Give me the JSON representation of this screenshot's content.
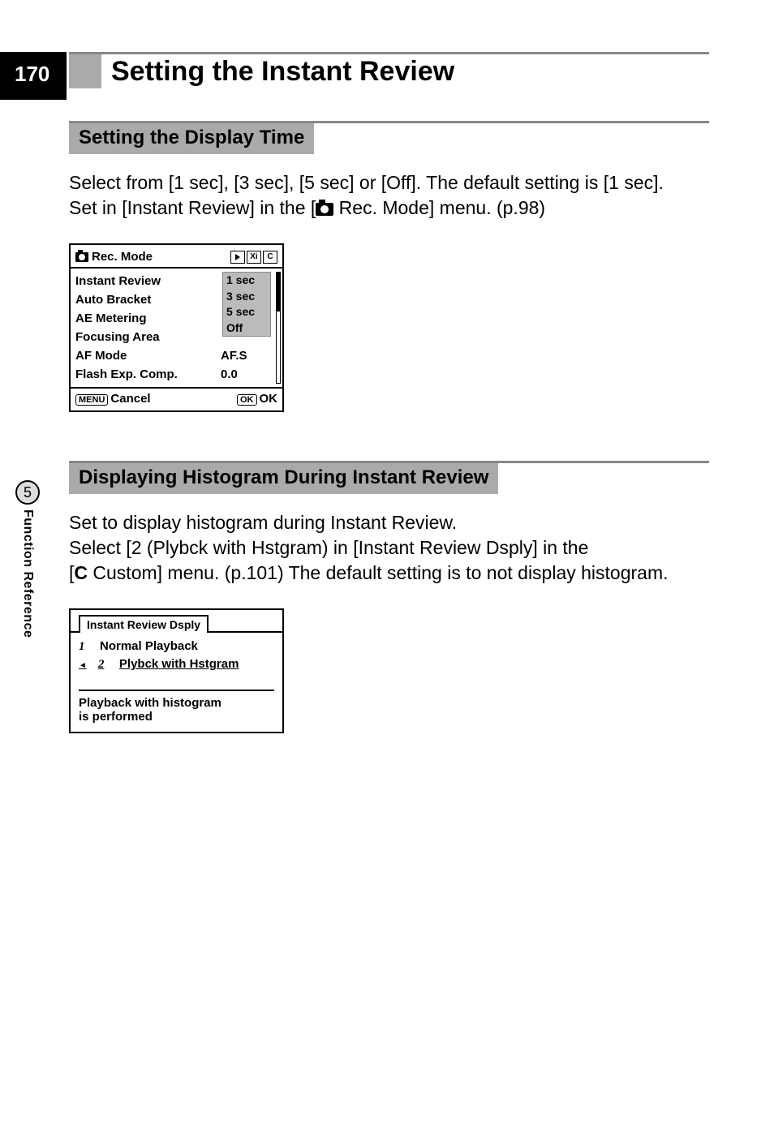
{
  "page_number": "170",
  "main_title": "Setting the Instant Review",
  "section1": {
    "header": "Setting the Display Time",
    "body_line1": "Select from [1 sec], [3 sec], [5 sec] or [Off]. The default setting is [1 sec].",
    "body_line2a": "Set in [Instant Review] in the [",
    "body_line2b": " Rec. Mode] menu. (p.98)"
  },
  "rec_mode_menu": {
    "title": "Rec. Mode",
    "tabs": [
      "▶",
      "Xi",
      "C"
    ],
    "items": [
      {
        "label": "Instant Review",
        "value": "1 sec"
      },
      {
        "label": "Auto Bracket",
        "value": ""
      },
      {
        "label": "AE Metering",
        "value": ""
      },
      {
        "label": "Focusing Area",
        "value": ""
      },
      {
        "label": "AF Mode",
        "value": "AF.S"
      },
      {
        "label": "Flash Exp. Comp.",
        "value": "0.0"
      }
    ],
    "dropdown_options": [
      "1 sec",
      "3 sec",
      "5 sec",
      "Off"
    ],
    "footer_left_btn": "MENU",
    "footer_left": "Cancel",
    "footer_right_btn": "OK",
    "footer_right": "OK"
  },
  "section2": {
    "header": "Displaying Histogram During Instant Review",
    "body_line1": "Set to display histogram during Instant Review.",
    "body_line2": "Select [2 (Plybck with Hstgram) in [Instant Review Dsply] in the",
    "body_line3a": "[",
    "body_line3_c": "C",
    "body_line3b": " Custom] menu. (p.101) The default setting is to not display histogram."
  },
  "hist_menu": {
    "tab": "Instant Review Dsply",
    "options": [
      {
        "num": "1",
        "label": "Normal Playback"
      },
      {
        "num": "2",
        "label": "Plybck with Hstgram"
      }
    ],
    "desc_line1": "Playback with histogram",
    "desc_line2": "is performed"
  },
  "side_tab": {
    "number": "5",
    "label": "Function Reference"
  }
}
